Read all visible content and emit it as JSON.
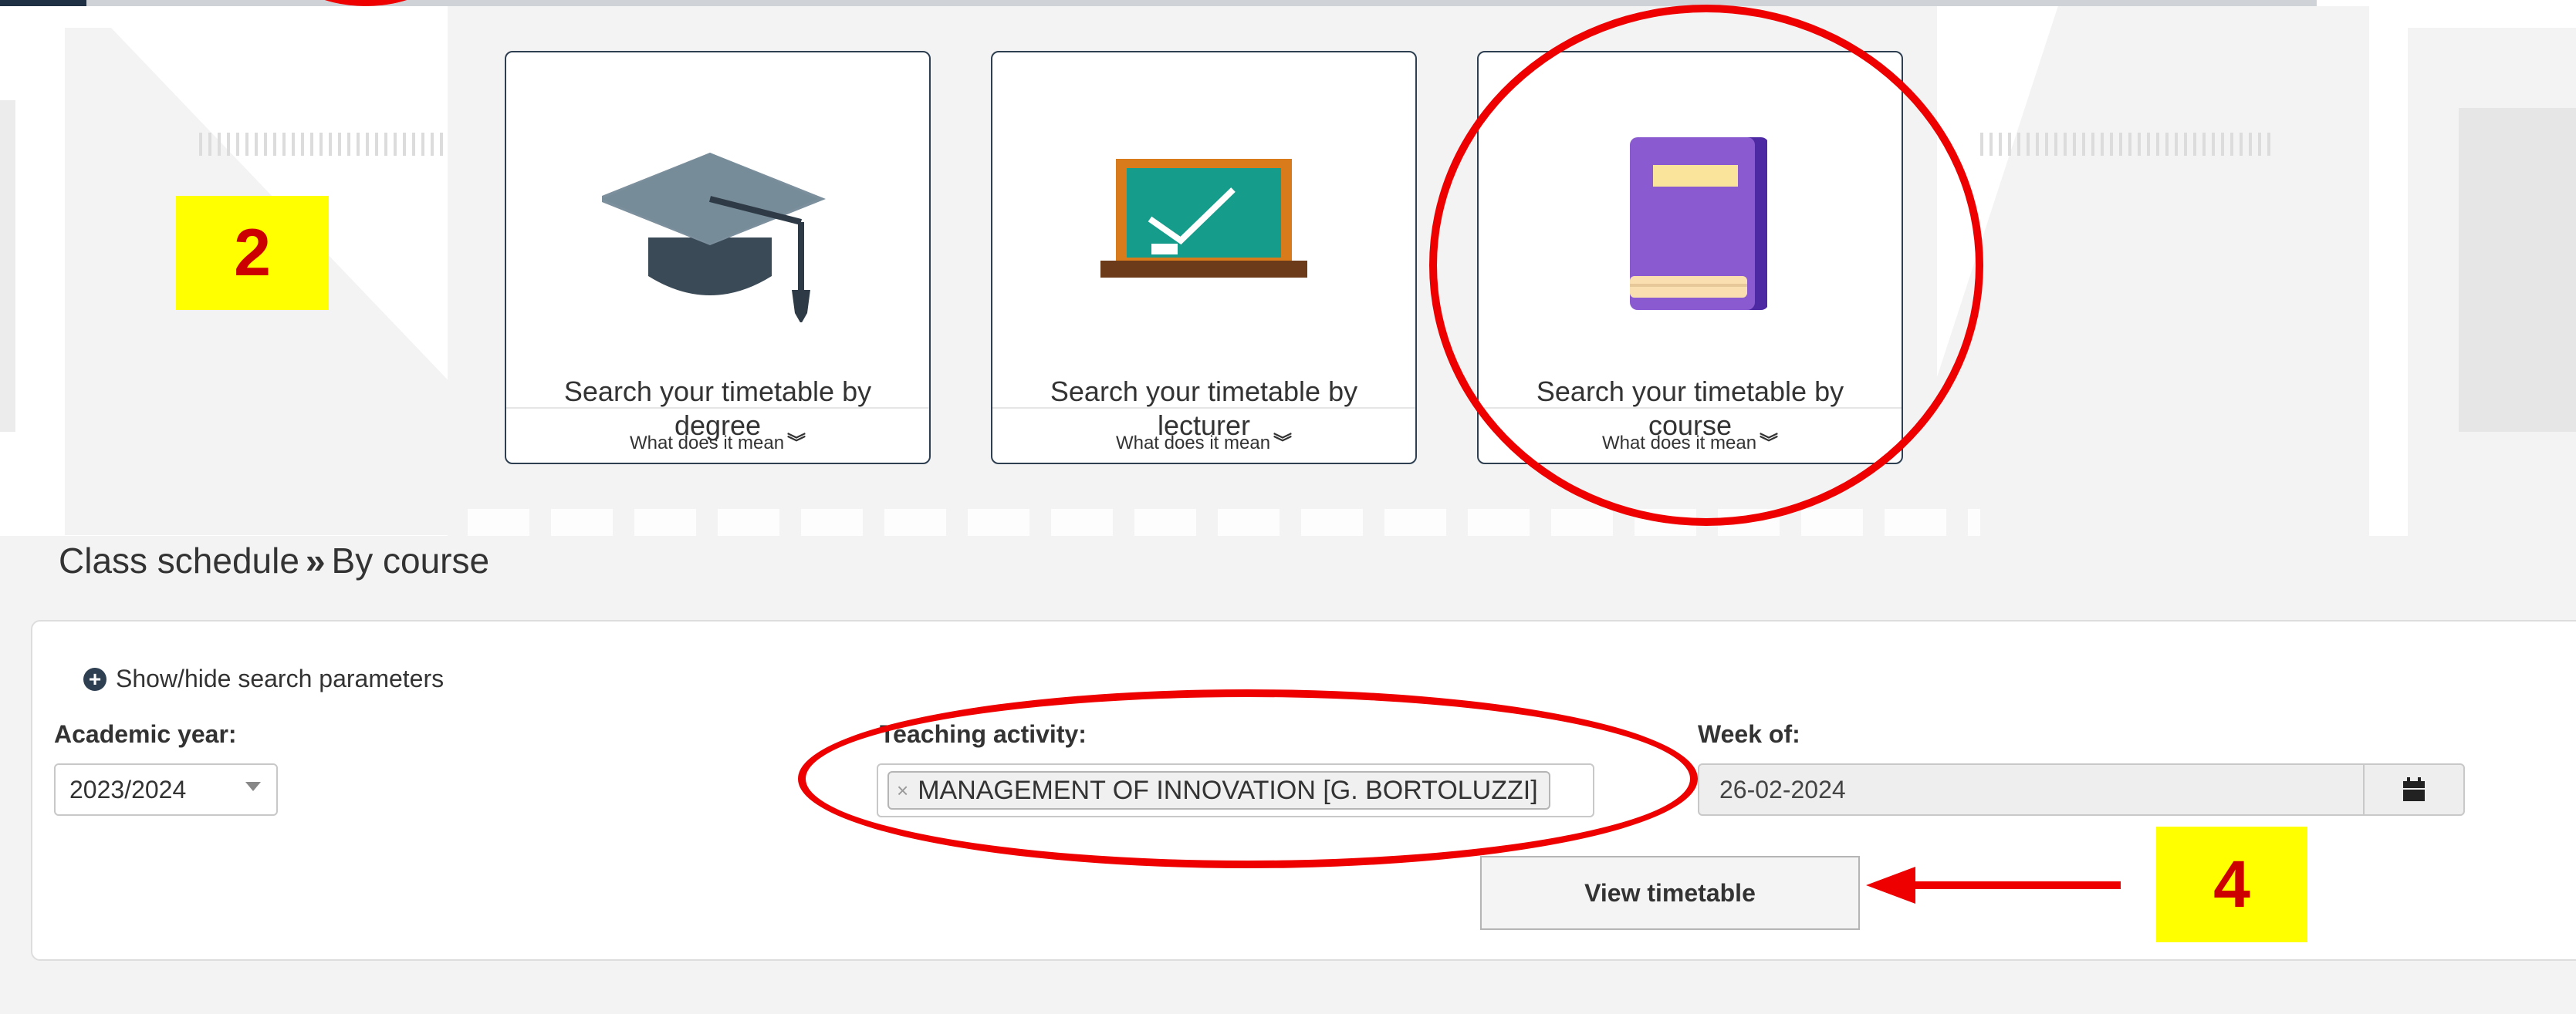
{
  "cards": [
    {
      "label": "Search your timetable by degree",
      "more": "What does it mean",
      "icon": "graduation-cap-icon"
    },
    {
      "label": "Search your timetable by lecturer",
      "more": "What does it mean",
      "icon": "chalkboard-icon"
    },
    {
      "label": "Search your timetable by course",
      "more": "What does it mean",
      "icon": "book-icon"
    }
  ],
  "annotations": {
    "step_2": "2",
    "step_4": "4",
    "highlight_color": "#ee0000",
    "marker_color": "#ffff00"
  },
  "breadcrumb": {
    "root": "Class schedule",
    "separator": "»",
    "current": "By course"
  },
  "form": {
    "toggle_label": "Show/hide search parameters",
    "academic_year_label": "Academic year:",
    "academic_year_value": "2023/2024",
    "teaching_activity_label": "Teaching activity:",
    "teaching_activity_tag": "MANAGEMENT OF INNOVATION [G. BORTOLUZZI]",
    "teaching_activity_remove": "×",
    "week_label": "Week of:",
    "week_value": "26-02-2024",
    "calendar_icon": "calendar-icon",
    "submit_label": "View timetable"
  }
}
